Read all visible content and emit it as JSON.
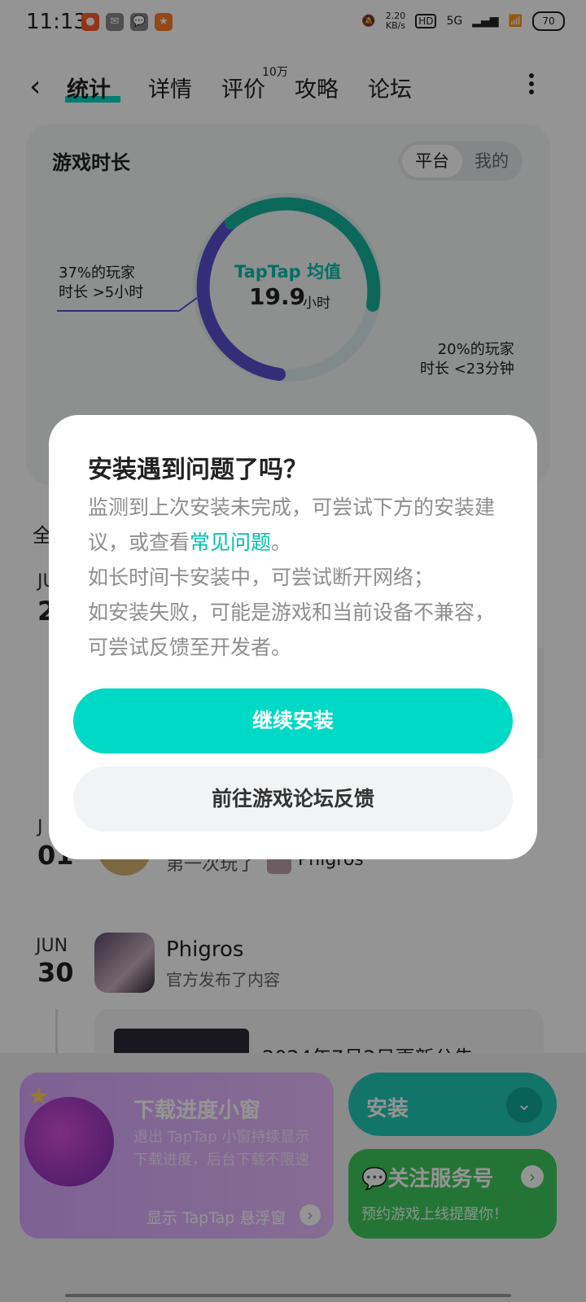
{
  "status_bar": {
    "time": "11:13",
    "net_speed_value": "2.20",
    "net_speed_unit": "KB/s",
    "hd": "HD",
    "network": "5G",
    "battery": "70"
  },
  "header": {
    "tabs": [
      {
        "label": "统计",
        "active": true
      },
      {
        "label": "详情"
      },
      {
        "label": "评价",
        "badge": "10万"
      },
      {
        "label": "攻略"
      },
      {
        "label": "论坛"
      }
    ]
  },
  "stats_card": {
    "title": "游戏时长",
    "segment": {
      "on": "平台",
      "off": "我的"
    },
    "avg_label": "TapTap 均值",
    "avg_value": "19.9",
    "avg_unit": "小时",
    "left_note_line1": "37%的玩家",
    "left_note_line2": "时长 >5小时",
    "right_note_line1": "20%的玩家",
    "right_note_line2": "时长 <23分钟",
    "colors": {
      "purple": "#5a4fcf",
      "teal": "#17b39f",
      "light": "#dfeeee"
    }
  },
  "feed": {
    "partial_all": "全",
    "item1_month": "JU",
    "item1_day": "2",
    "item2_month": "J",
    "item2_day": "01",
    "item2_text": "第一次玩了",
    "item2_game": "Phigros",
    "item3_month": "JUN",
    "item3_day": "30",
    "game_name": "Phigros",
    "game_sub": "官方发布了内容",
    "post_title": "2024年7月2日更新公告"
  },
  "promo": {
    "title": "下载进度小窗",
    "desc": "退出 TapTap 小窗持续显示下载进度，后台下载不限速",
    "link": "显示 TapTap 悬浮窗"
  },
  "install": {
    "label": "安装"
  },
  "follow": {
    "title": "关注服务号",
    "sub": "预约游戏上线提醒你！"
  },
  "dialog": {
    "title": "安装遇到问题了吗？",
    "body_part1": "监测到上次安装未完成，可尝试下方的安装建议，或查看",
    "body_link": "常见问题",
    "body_part2": "。",
    "line2": "如长时间卡安装中，可尝试断开网络；",
    "line3": "如安装失败，可能是游戏和当前设备不兼容，可尝试反馈至开发者。",
    "primary": "继续安装",
    "secondary": "前往游戏论坛反馈",
    "accent": "#00d9c5"
  }
}
